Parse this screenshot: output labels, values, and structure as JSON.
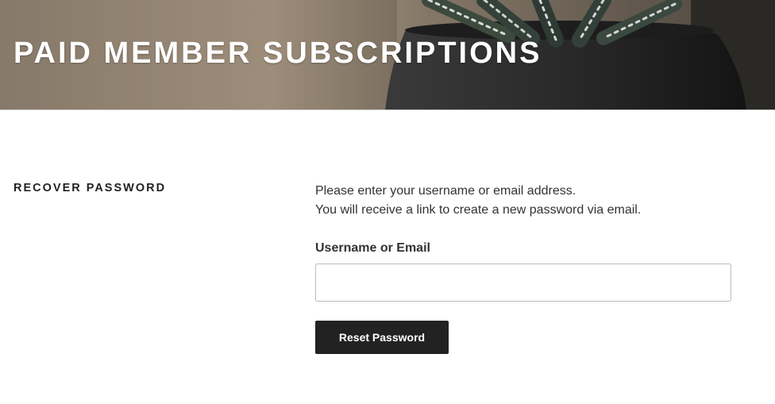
{
  "site": {
    "title": "PAID MEMBER SUBSCRIPTIONS"
  },
  "page": {
    "title": "RECOVER PASSWORD"
  },
  "form": {
    "intro_line1": "Please enter your username or email address.",
    "intro_line2": "You will receive a link to create a new password via email.",
    "field_label": "Username or Email",
    "field_value": "",
    "submit_label": "Reset Password"
  },
  "colors": {
    "button_bg": "#222222",
    "button_text": "#ffffff",
    "title_text": "#ffffff",
    "body_text": "#333333"
  }
}
